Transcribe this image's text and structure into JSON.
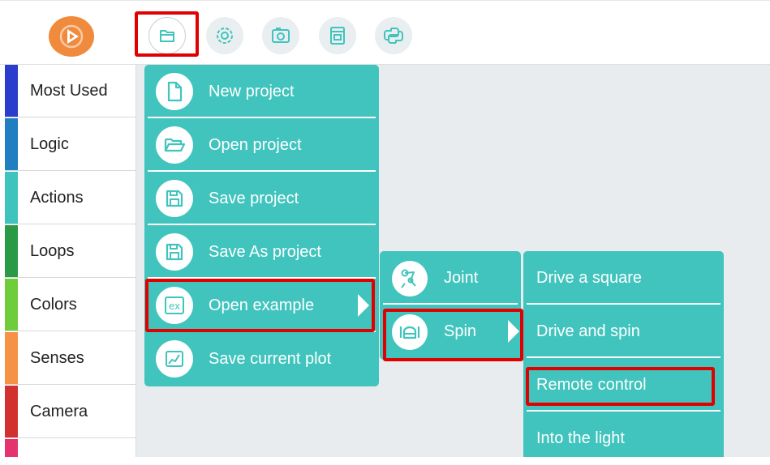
{
  "colors": {
    "accent": "#40c4bd",
    "logo": "#f08a3c",
    "highlight": "#e00000"
  },
  "toolbar": {
    "logo_icon": "play-logo-icon",
    "buttons": [
      {
        "icon": "folder-icon",
        "active": true
      },
      {
        "icon": "gear-icon"
      },
      {
        "icon": "camera-icon"
      },
      {
        "icon": "archive-icon"
      },
      {
        "icon": "python-icon"
      }
    ]
  },
  "sidebar": {
    "categories": [
      {
        "label": "Most Used",
        "color": "#2a3dcc"
      },
      {
        "label": "Logic",
        "color": "#1f7fc1"
      },
      {
        "label": "Actions",
        "color": "#3fc4bd"
      },
      {
        "label": "Loops",
        "color": "#2a9a46"
      },
      {
        "label": "Colors",
        "color": "#6fcc3a"
      },
      {
        "label": "Senses",
        "color": "#f59245"
      },
      {
        "label": "Camera",
        "color": "#d1322f"
      },
      {
        "label": "",
        "color": "#e5336d"
      }
    ]
  },
  "file_menu": {
    "items": [
      {
        "label": "New project",
        "icon": "new-file-icon"
      },
      {
        "label": "Open project",
        "icon": "open-folder-icon"
      },
      {
        "label": "Save project",
        "icon": "save-icon"
      },
      {
        "label": "Save As project",
        "icon": "save-as-icon"
      },
      {
        "label": "Open example",
        "icon": "example-icon",
        "ex_text": "ex",
        "submenu": true
      },
      {
        "label": "Save current plot",
        "icon": "plot-icon"
      }
    ]
  },
  "example_menu": {
    "items": [
      {
        "label": "Joint",
        "icon": "joint-icon"
      },
      {
        "label": "Spin",
        "icon": "spin-icon",
        "submenu": true
      }
    ]
  },
  "spin_menu": {
    "items": [
      {
        "label": "Drive a square"
      },
      {
        "label": "Drive and spin"
      },
      {
        "label": "Remote control"
      },
      {
        "label": "Into the light"
      }
    ]
  }
}
